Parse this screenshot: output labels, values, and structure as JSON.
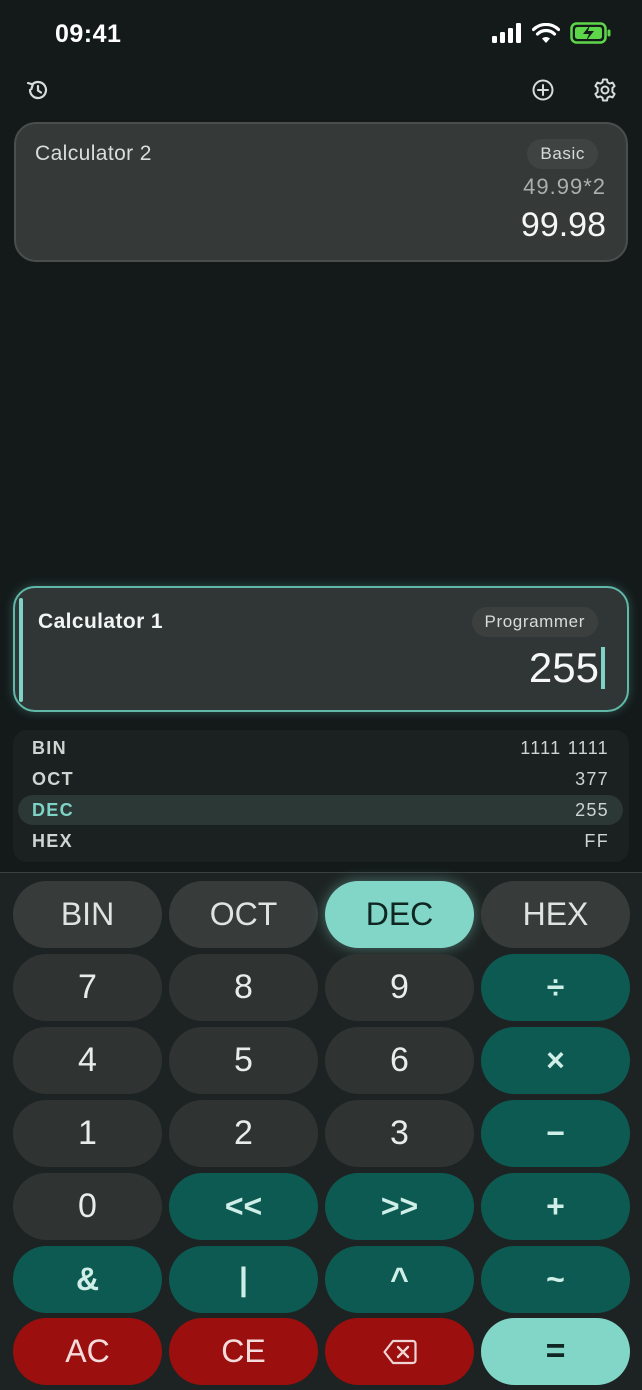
{
  "status_bar": {
    "time": "09:41"
  },
  "toolbar": {
    "history_icon": "history-icon",
    "add_icon": "add-circle-icon",
    "settings_icon": "gear-icon"
  },
  "calculators": [
    {
      "title": "Calculator 2",
      "mode": "Basic",
      "expression": "49.99*2",
      "result": "99.98"
    },
    {
      "title": "Calculator 1",
      "mode": "Programmer",
      "result": "255"
    }
  ],
  "bases": [
    {
      "name": "BIN",
      "value": "1111 1111",
      "active": false
    },
    {
      "name": "OCT",
      "value": "377",
      "active": false
    },
    {
      "name": "DEC",
      "value": "255",
      "active": true
    },
    {
      "name": "HEX",
      "value": "FF",
      "active": false
    }
  ],
  "keypad": {
    "rows": [
      [
        "BIN",
        "OCT",
        "DEC",
        "HEX"
      ],
      [
        "7",
        "8",
        "9",
        "÷"
      ],
      [
        "4",
        "5",
        "6",
        "×"
      ],
      [
        "1",
        "2",
        "3",
        "−"
      ],
      [
        "0",
        "<<",
        ">>",
        "+"
      ],
      [
        "&",
        "|",
        "^",
        "~"
      ],
      [
        "AC",
        "CE",
        "backspace-icon",
        "="
      ]
    ],
    "active_base": "DEC"
  },
  "colors": {
    "background": "#141a1a",
    "accent": "#82d6c8",
    "operator": "#0d5a52",
    "danger": "#9b0f0f"
  }
}
